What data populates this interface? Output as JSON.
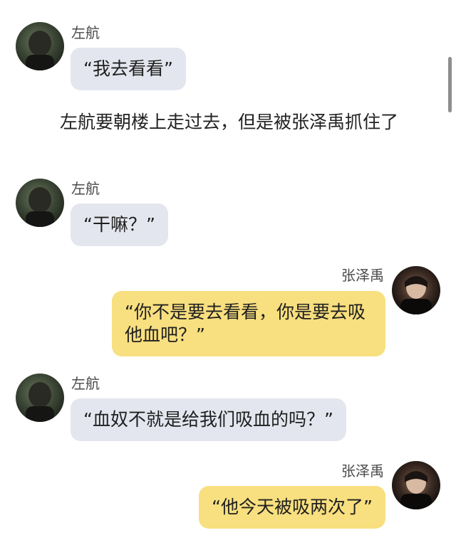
{
  "messages": [
    {
      "side": "left",
      "sender": "左航",
      "text": "“我去看看”"
    },
    {
      "side": "left",
      "sender": "左航",
      "text": "“干嘛？”"
    },
    {
      "side": "right",
      "sender": "张泽禹",
      "text": "“你不是要去看看，你是要去吸他血吧？”"
    },
    {
      "side": "left",
      "sender": "左航",
      "text": "“血奴不就是给我们吸血的吗？”"
    },
    {
      "side": "right",
      "sender": "张泽禹",
      "text": "“他今天被吸两次了”"
    }
  ],
  "narration": "左航要朝楼上走过去，但是被张泽禹抓住了",
  "avatars": {
    "left": "avatar-zuohang",
    "right": "avatar-zhangzeyu"
  },
  "colors": {
    "left_bubble": "#e3e6ee",
    "right_bubble": "#f8df7f",
    "background": "#ffffff"
  }
}
